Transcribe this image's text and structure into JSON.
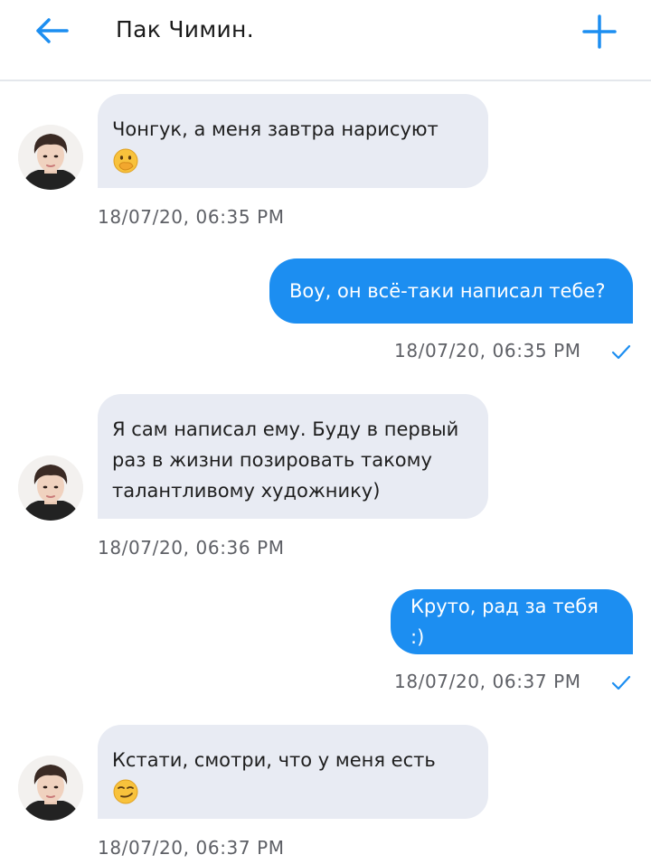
{
  "header": {
    "title": "Пак Чимин.",
    "back_icon": "arrow-left-icon",
    "action_icon": "plus-icon",
    "accent_color": "#1c8ef1"
  },
  "messages": [
    {
      "direction": "incoming",
      "text": "Чонгук, а меня завтра нарисуют",
      "emoji": "face-with-hand-over-mouth",
      "time": "18/07/20, 06:35 PM"
    },
    {
      "direction": "outgoing",
      "text": "Воу, он всё-таки написал тебе?",
      "time": "18/07/20, 06:35 PM",
      "status": "check-icon"
    },
    {
      "direction": "incoming",
      "lines": [
        "Я сам написал ему. Буду в первый",
        "раз в жизни позировать такому",
        "талантливому художнику)"
      ],
      "time": "18/07/20, 06:36 PM"
    },
    {
      "direction": "outgoing",
      "text": "Круто, рад за тебя :)",
      "time": "18/07/20, 06:37 PM",
      "status": "check-icon"
    },
    {
      "direction": "incoming",
      "text": "Кстати, смотри, что у меня есть",
      "emoji": "smirking-face",
      "time": "18/07/20, 06:37 PM"
    }
  ]
}
